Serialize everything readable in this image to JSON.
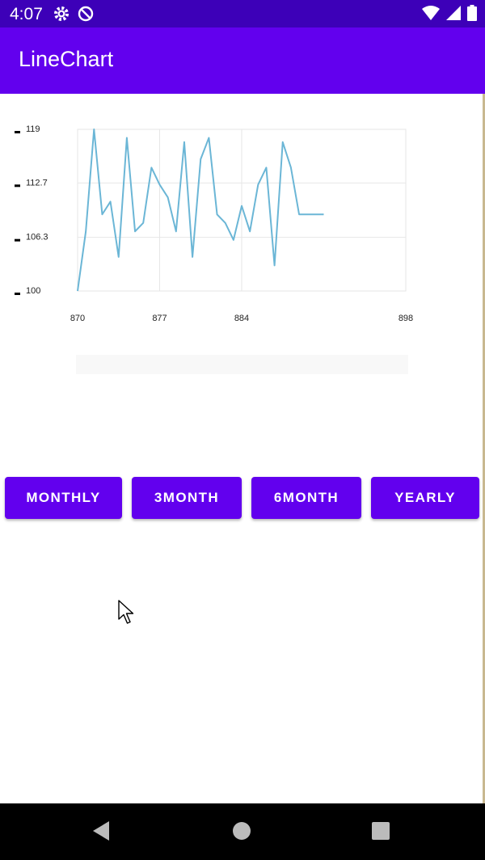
{
  "status_bar": {
    "time": "4:07",
    "icons": [
      "gear-icon",
      "do-not-disturb-icon",
      "wifi-icon",
      "signal-icon",
      "battery-icon"
    ]
  },
  "app_bar": {
    "title": "LineChart"
  },
  "colors": {
    "status_bar": "#3d00b8",
    "app_bar": "#6200ee",
    "accent_button": "#6200ee",
    "line": "#6bb6d6",
    "grid": "#e6e6e6"
  },
  "chart_data": {
    "type": "line",
    "title": "",
    "xlabel": "",
    "ylabel": "",
    "xlim": [
      870,
      898
    ],
    "ylim": [
      100,
      119
    ],
    "xticks": [
      "870",
      "877",
      "884",
      "898"
    ],
    "yticks": [
      "100",
      "106.3",
      "112.7",
      "119"
    ],
    "grid": true,
    "legend": "none",
    "series": [
      {
        "x": [
          870,
          870.7,
          871.4,
          872.1,
          872.8,
          873.5,
          874.2,
          874.9,
          875.6,
          876.3,
          877,
          877.7,
          878.4,
          879.1,
          879.8,
          880.5,
          881.2,
          881.9,
          882.6,
          883.3,
          884,
          884.7,
          885.4,
          886.1,
          886.8,
          887.5,
          888.2,
          888.9,
          889.6,
          890.3,
          891
        ],
        "y": [
          100,
          107,
          119,
          109,
          110.5,
          104,
          118,
          107,
          108,
          114.5,
          112.5,
          111,
          107,
          117.5,
          104,
          115.5,
          118,
          109,
          108,
          106,
          110,
          107,
          112.5,
          114.5,
          103,
          117.5,
          114.5,
          109,
          109,
          109,
          109
        ]
      }
    ]
  },
  "buttons": [
    "MONTHLY",
    "3MONTH",
    "6MONTH",
    "YEARLY"
  ],
  "nav": [
    "back-icon",
    "home-icon",
    "recents-icon"
  ]
}
